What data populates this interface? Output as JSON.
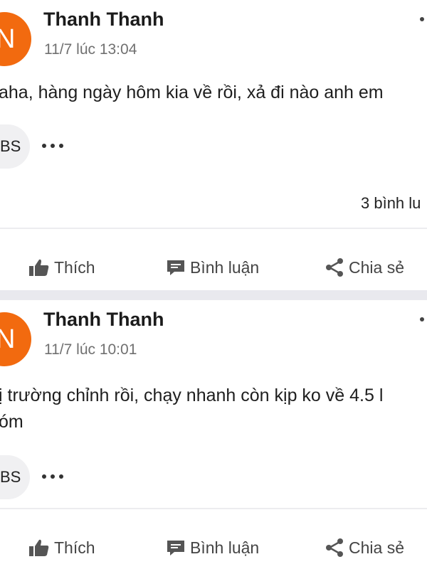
{
  "posts": [
    {
      "avatar_letter": "N",
      "author": "Thanh Thanh",
      "timestamp": "11/7 lúc 13:04",
      "content_lines": [
        "aha, hàng ngày hôm kia về rồi, xả đi nào anh em"
      ],
      "tag": "BS",
      "comment_count": "3 bình lu",
      "actions": {
        "like": "Thích",
        "comment": "Bình luận",
        "share": "Chia sẻ"
      }
    },
    {
      "avatar_letter": "N",
      "author": "Thanh Thanh",
      "timestamp": "11/7 lúc 10:01",
      "content_lines": [
        "ị trường chỉnh rồi, chạy nhanh còn kịp ko về 4.5 l",
        "óm"
      ],
      "tag": "BS",
      "actions": {
        "like": "Thích",
        "comment": "Bình luận",
        "share": "Chia sẻ"
      }
    }
  ],
  "colors": {
    "avatar": "#f26a0f",
    "separator": "#e9e9ee",
    "action_text": "#444444"
  },
  "icons": {
    "like": "thumbs-up-icon",
    "comment": "comment-icon",
    "share": "share-icon",
    "more": "more-dots-icon"
  }
}
